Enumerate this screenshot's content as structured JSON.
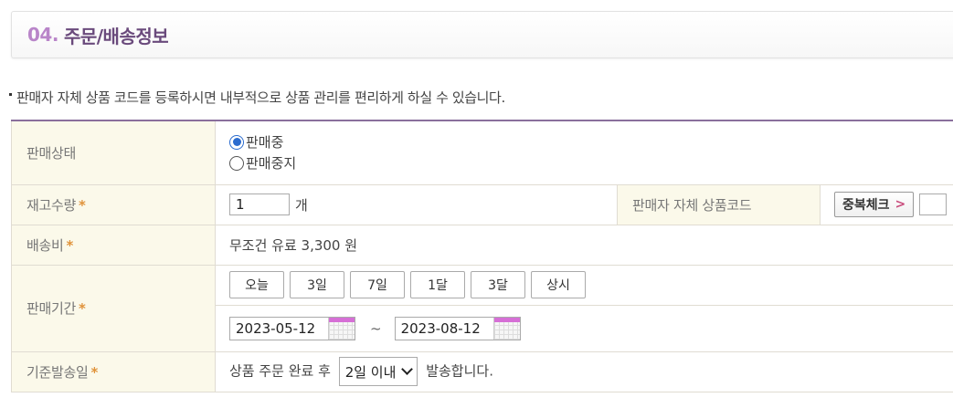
{
  "section": {
    "number": "04.",
    "title": "주문/배송정보"
  },
  "notice": "판매자 자체 상품 코드를 등록하시면 내부적으로 상품 관리를 편리하게 하실 수 있습니다.",
  "required_mark": "*",
  "sale_status": {
    "label": "판매상태",
    "options": [
      {
        "label": "판매중",
        "checked": true
      },
      {
        "label": "판매중지",
        "checked": false
      }
    ]
  },
  "stock": {
    "label": "재고수량",
    "value": "1",
    "unit": "개"
  },
  "seller_code": {
    "label": "판매자 자체 상품코드",
    "check_button": "중복체크",
    "button_arrow": ">"
  },
  "shipping": {
    "label": "배송비",
    "value": "무조건 유료 3,300 원"
  },
  "period": {
    "label": "판매기간",
    "buttons": [
      "오늘",
      "3일",
      "7일",
      "1달",
      "3달",
      "상시"
    ],
    "start_date": "2023-05-12",
    "end_date": "2023-08-12",
    "separator": "~"
  },
  "dispatch": {
    "label": "기준발송일",
    "prefix": "상품 주문 완료 후",
    "selected": "2일 이내",
    "suffix": "발송합니다."
  },
  "colors": {
    "accent": "#b985c9",
    "title": "#6a4a7c",
    "label_bg": "#fbf9ea",
    "required": "#e0933b"
  }
}
